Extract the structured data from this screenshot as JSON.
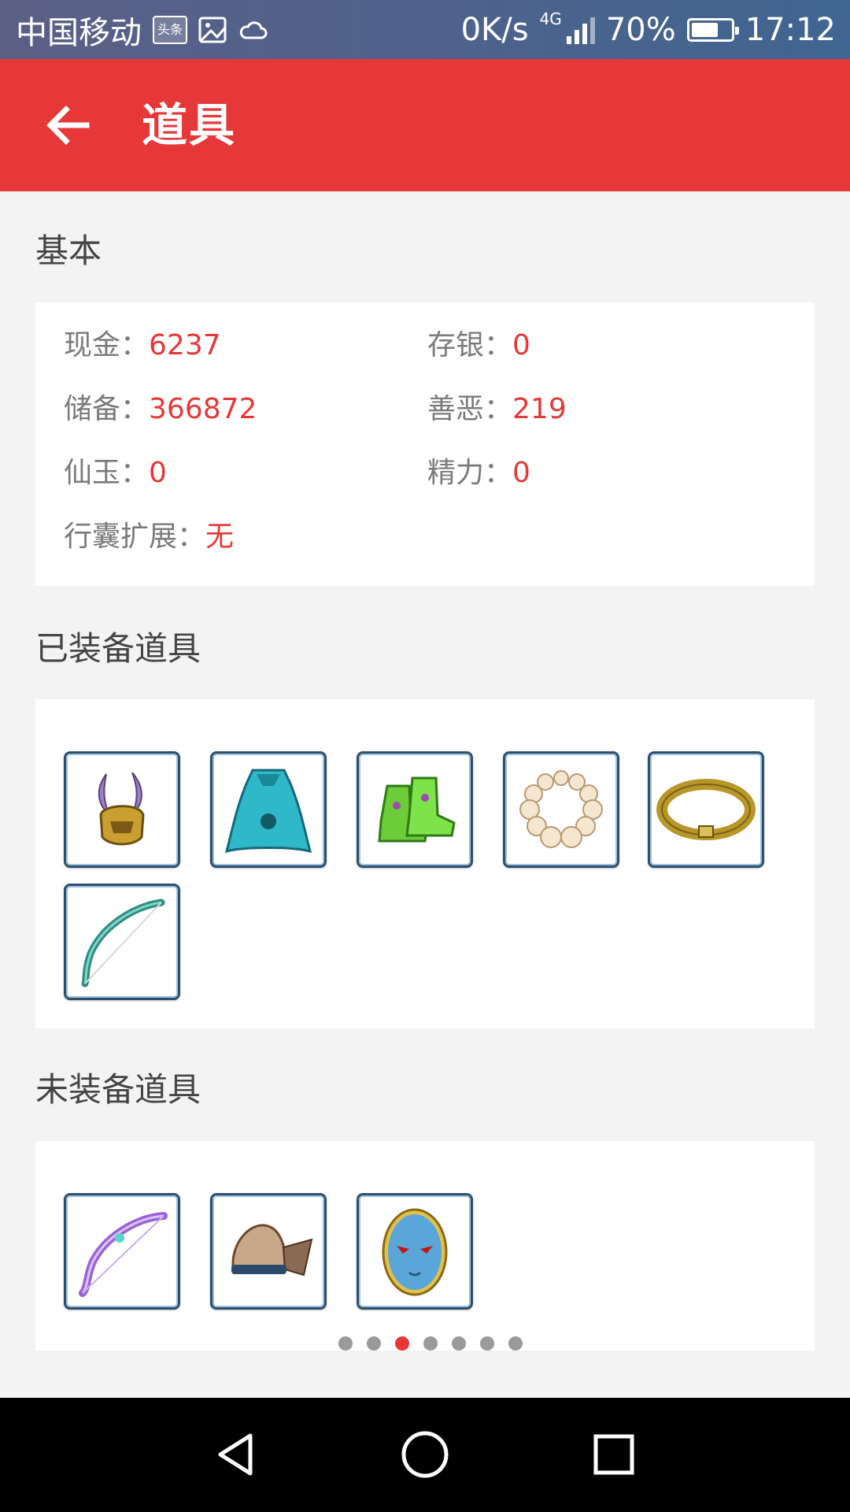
{
  "status_bar": {
    "carrier": "中国移动",
    "news_badge": "头条",
    "net_speed": "0K/s",
    "network_type": "4G",
    "battery": "70%",
    "battery_level": 0.7,
    "time": "17:12"
  },
  "app_bar": {
    "title": "道具",
    "back_icon": "arrow-left-icon"
  },
  "basic": {
    "section_title": "基本",
    "items": [
      {
        "label": "现金：",
        "value": "6237"
      },
      {
        "label": "存银：",
        "value": "0"
      },
      {
        "label": "储备：",
        "value": "366872"
      },
      {
        "label": "善恶：",
        "value": "219"
      },
      {
        "label": "仙玉：",
        "value": "0"
      },
      {
        "label": "精力：",
        "value": "0"
      },
      {
        "label": "行囊扩展：",
        "value": "无"
      }
    ]
  },
  "equipped": {
    "section_title": "已装备道具",
    "items": [
      {
        "icon": "horned-helmet-icon"
      },
      {
        "icon": "teal-cape-icon"
      },
      {
        "icon": "green-boots-icon"
      },
      {
        "icon": "pearl-necklace-icon"
      },
      {
        "icon": "gold-belt-icon"
      },
      {
        "icon": "jade-bow-icon"
      }
    ]
  },
  "unequipped": {
    "section_title": "未装备道具",
    "items": [
      {
        "icon": "purple-bow-icon"
      },
      {
        "icon": "cloth-hat-icon"
      },
      {
        "icon": "blue-mask-icon"
      }
    ]
  },
  "pager": {
    "count": 7,
    "active_index": 2
  },
  "nav_bar": {
    "back_icon": "triangle-back-icon",
    "home_icon": "circle-home-icon",
    "recents_icon": "square-recents-icon"
  }
}
